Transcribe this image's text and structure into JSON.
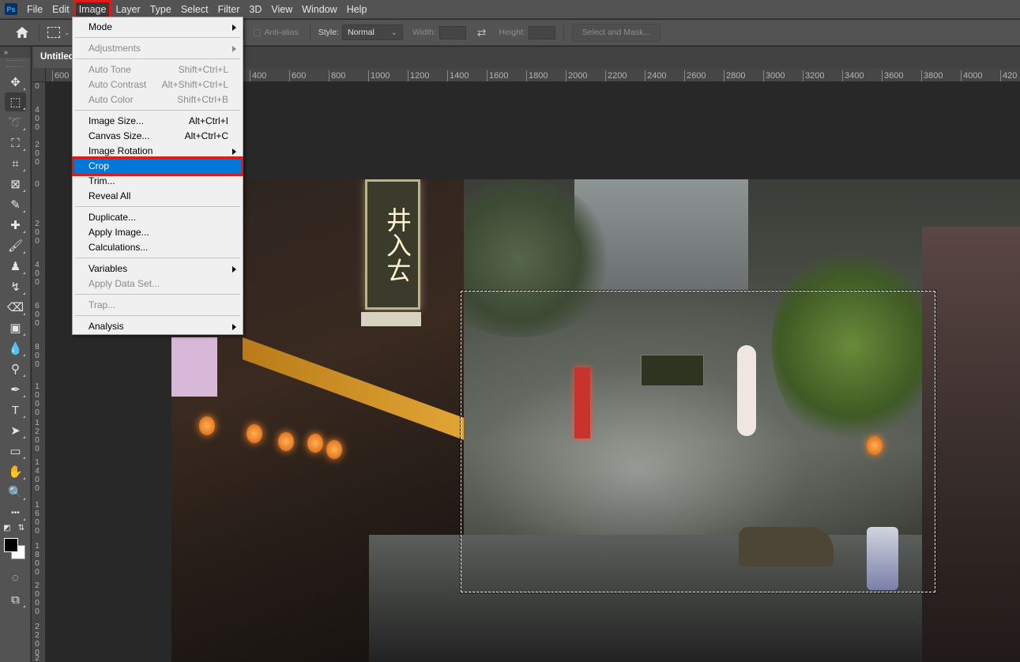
{
  "app": {
    "logo": "Ps",
    "menu": [
      "File",
      "Edit",
      "Image",
      "Layer",
      "Type",
      "Select",
      "Filter",
      "3D",
      "View",
      "Window",
      "Help"
    ],
    "active_menu": "Image"
  },
  "options_bar": {
    "anti_alias_label": "Anti-alias",
    "style_label": "Style:",
    "style_value": "Normal",
    "width_label": "Width:",
    "width_value": "",
    "height_label": "Height:",
    "height_value": "",
    "select_mask_label": "Select and Mask..."
  },
  "document": {
    "tab_title": "Untitled"
  },
  "rulers": {
    "top": [
      "600",
      "400",
      "600",
      "800",
      "1000",
      "1200",
      "1400",
      "1600",
      "1800",
      "2000",
      "2200",
      "2400",
      "2600",
      "2800",
      "3000",
      "3200",
      "3400",
      "3600",
      "3800",
      "4000",
      "420"
    ],
    "left": [
      "0",
      "400",
      "200",
      "0",
      "200",
      "400",
      "600",
      "800",
      "0",
      "1000",
      "1200",
      "1400",
      "1600",
      "1800",
      "2000",
      "2200",
      "2"
    ]
  },
  "toolbar": {
    "collapse_label": "»",
    "tools": [
      {
        "name": "move-tool",
        "glyph": "✥"
      },
      {
        "name": "rectangular-marquee-tool",
        "glyph": "⬚"
      },
      {
        "name": "lasso-tool",
        "glyph": "➰"
      },
      {
        "name": "object-selection-tool",
        "glyph": "⛶"
      },
      {
        "name": "crop-tool",
        "glyph": "⌗"
      },
      {
        "name": "frame-tool",
        "glyph": "⊠"
      },
      {
        "name": "eyedropper-tool",
        "glyph": "✎"
      },
      {
        "name": "healing-brush-tool",
        "glyph": "✚"
      },
      {
        "name": "brush-tool",
        "glyph": "🖌"
      },
      {
        "name": "clone-stamp-tool",
        "glyph": "♟"
      },
      {
        "name": "history-brush-tool",
        "glyph": "↯"
      },
      {
        "name": "eraser-tool",
        "glyph": "⌫"
      },
      {
        "name": "gradient-tool",
        "glyph": "▣"
      },
      {
        "name": "blur-tool",
        "glyph": "💧"
      },
      {
        "name": "dodge-tool",
        "glyph": "⚲"
      },
      {
        "name": "pen-tool",
        "glyph": "✒"
      },
      {
        "name": "type-tool",
        "glyph": "T"
      },
      {
        "name": "path-selection-tool",
        "glyph": "➤"
      },
      {
        "name": "rectangle-tool",
        "glyph": "▭"
      },
      {
        "name": "hand-tool",
        "glyph": "✋"
      },
      {
        "name": "zoom-tool",
        "glyph": "🔍"
      },
      {
        "name": "edit-toolbar",
        "glyph": "•••"
      }
    ],
    "bottom": [
      {
        "name": "quick-mask-mode",
        "glyph": "◌"
      },
      {
        "name": "screen-mode",
        "glyph": "⧉"
      }
    ],
    "foreground_color": "#000000",
    "background_color": "#ffffff"
  },
  "image_menu": {
    "items": [
      {
        "label": "Mode",
        "shortcut": "",
        "submenu": true,
        "disabled": false
      },
      {
        "sep": true
      },
      {
        "label": "Adjustments",
        "shortcut": "",
        "submenu": true,
        "disabled": true
      },
      {
        "sep": true
      },
      {
        "label": "Auto Tone",
        "shortcut": "Shift+Ctrl+L",
        "submenu": false,
        "disabled": true
      },
      {
        "label": "Auto Contrast",
        "shortcut": "Alt+Shift+Ctrl+L",
        "submenu": false,
        "disabled": true
      },
      {
        "label": "Auto Color",
        "shortcut": "Shift+Ctrl+B",
        "submenu": false,
        "disabled": true
      },
      {
        "sep": true
      },
      {
        "label": "Image Size...",
        "shortcut": "Alt+Ctrl+I",
        "submenu": false,
        "disabled": false
      },
      {
        "label": "Canvas Size...",
        "shortcut": "Alt+Ctrl+C",
        "submenu": false,
        "disabled": false
      },
      {
        "label": "Image Rotation",
        "shortcut": "",
        "submenu": true,
        "disabled": false
      },
      {
        "label": "Crop",
        "shortcut": "",
        "submenu": false,
        "disabled": false,
        "highlighted": true
      },
      {
        "label": "Trim...",
        "shortcut": "",
        "submenu": false,
        "disabled": false
      },
      {
        "label": "Reveal All",
        "shortcut": "",
        "submenu": false,
        "disabled": false
      },
      {
        "sep": true
      },
      {
        "label": "Duplicate...",
        "shortcut": "",
        "submenu": false,
        "disabled": false
      },
      {
        "label": "Apply Image...",
        "shortcut": "",
        "submenu": false,
        "disabled": false
      },
      {
        "label": "Calculations...",
        "shortcut": "",
        "submenu": false,
        "disabled": false
      },
      {
        "sep": true
      },
      {
        "label": "Variables",
        "shortcut": "",
        "submenu": true,
        "disabled": false
      },
      {
        "label": "Apply Data Set...",
        "shortcut": "",
        "submenu": false,
        "disabled": true
      },
      {
        "sep": true
      },
      {
        "label": "Trap...",
        "shortcut": "",
        "submenu": false,
        "disabled": true
      },
      {
        "sep": true
      },
      {
        "label": "Analysis",
        "shortcut": "",
        "submenu": true,
        "disabled": false
      }
    ]
  },
  "canvas": {
    "image_description": "Futuristic cyberpunk street scene with neon signs, trees and wet pavement",
    "sign_text": "井入ㄊ",
    "has_selection": true
  },
  "colors": {
    "highlight": "#0078d7",
    "annotation_red": "#e31818",
    "chrome": "#535353",
    "canvas_bg": "#282828"
  }
}
